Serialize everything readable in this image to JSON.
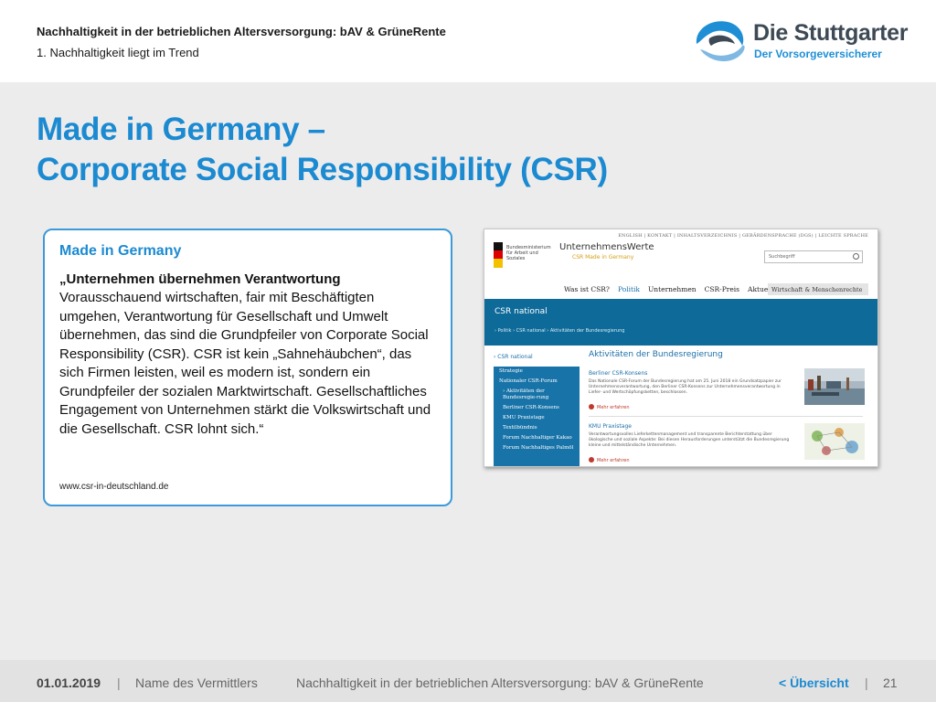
{
  "header": {
    "title": "Nachhaltigkeit in der betrieblichen Altersversorgung: bAV & GrüneRente",
    "subtitle": "1. Nachhaltigkeit liegt im Trend"
  },
  "logo": {
    "name": "Die Stuttgarter",
    "tagline": "Der Vorsorgeversicherer",
    "colors": {
      "primary": "#1e8fd5",
      "dark": "#3d4a55"
    }
  },
  "main_title": {
    "line1": "Made in Germany –",
    "line2": "Corporate Social Responsibility (CSR)"
  },
  "card": {
    "heading": "Made in Germany",
    "quote_head": "„Unternehmen übernehmen Verantwortung",
    "body": "Vorausschauend wirtschaften, fair mit Beschäftigten umgehen, Verantwortung für Gesellschaft und Umwelt übernehmen, das sind die Grundpfeiler von Corporate Social Responsibility (CSR). CSR ist kein „Sahnehäubchen“, das sich Firmen leisten, weil es modern ist, sondern ein Grundpfeiler der sozialen Marktwirtschaft. Gesellschaftliches Engagement von Unternehmen stärkt die Volkswirtschaft und die Gesellschaft. CSR lohnt sich.“",
    "link": "www.csr-in-deutschland.de"
  },
  "screenshot": {
    "top_links": "ENGLISH  |  KONTAKT  |  INHALTSVERZEICHNIS  |  GEBÄRDENSPRACHE (DGS)  |  LEICHTE SPRACHE",
    "ministry": "Bundesministerium für Arbeit und Soziales",
    "brand": "UnternehmensWerte",
    "brand_sub": "CSR Made in Germany",
    "search_placeholder": "Suchbegriff",
    "nav": [
      "Was ist CSR?",
      "Politik",
      "Unternehmen",
      "CSR-Preis",
      "Aktuelles"
    ],
    "nav_tab": "Wirtschaft & Menschenrechte",
    "banner_title": "CSR national",
    "breadcrumb": "› Politik  › CSR national  › Aktivitäten der Bundesregierung",
    "side_head": "› CSR national",
    "side_items": [
      "Strategie",
      "Nationaler CSR-Forum",
      "› Aktivitäten der Bundesregie-rung",
      "Berliner CSR-Konsens",
      "KMU Praxistage",
      "Textilbündnis",
      "Forum Nachhaltiger Kakao",
      "Forum Nachhaltiges Palmöl"
    ],
    "h2": "Aktivitäten der Bundesregierung",
    "article1_title": "Berliner CSR-Konsens",
    "article1_text": "Das Nationale CSR-Forum der Bundesregierung hat am 25. Juni 2018 ein Grundsatzpapier zur Unternehmensverantwortung, den Berliner CSR-Konsens zur Unternehmensverantwortung in Liefer- und Wertschöpfungsketten, beschlossen.",
    "article2_title": "KMU Praxistage",
    "article2_text": "Verantwortungsvolles Lieferkettenmanagement und transparente Berichterstattung über ökologische und soziale Aspekte: Bei diesen Herausforderungen unterstützt die Bundesregierung kleine und mittelständische Unternehmen.",
    "more_label": "Mehr erfahren"
  },
  "footer": {
    "date": "01.01.2019",
    "sep": "|",
    "agent": "Name des Vermittlers",
    "topic": "Nachhaltigkeit in der betrieblichen Altersversorgung: bAV & GrüneRente",
    "nav_label": "< Übersicht",
    "page": "21"
  }
}
